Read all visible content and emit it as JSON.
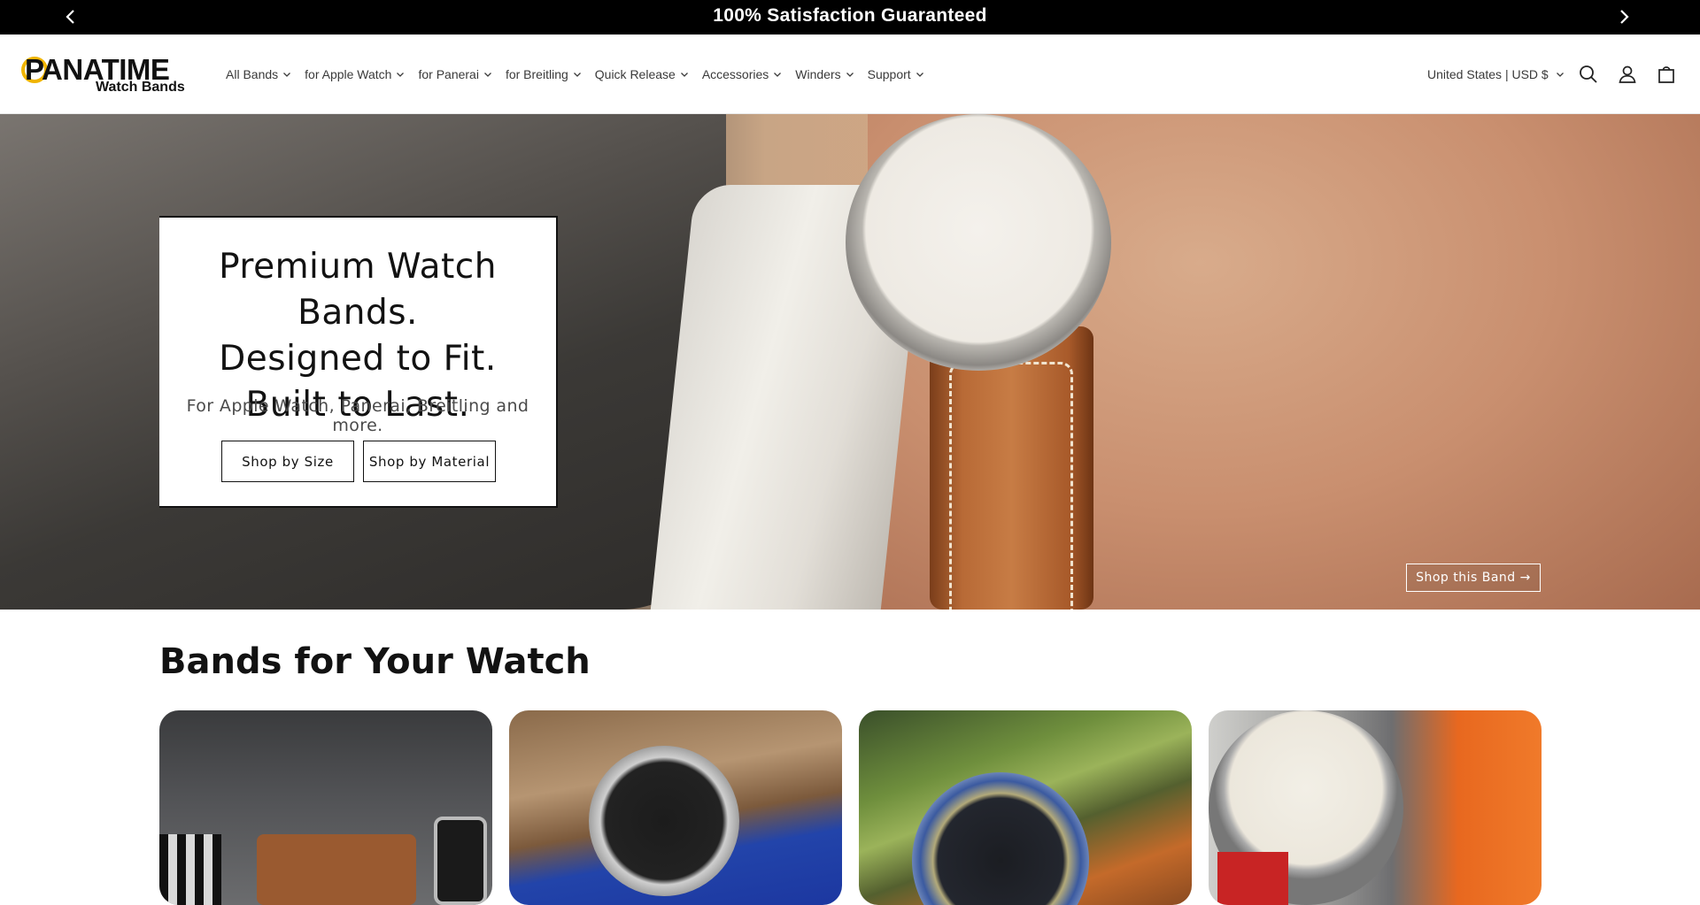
{
  "announcement": {
    "message": "100% Satisfaction Guaranteed",
    "prev_icon": "chevron-left-icon",
    "next_icon": "chevron-right-icon"
  },
  "brand": {
    "logo_word": "PANATIME",
    "logo_sub": "Watch Bands",
    "accent_color": "#f0b400"
  },
  "nav": {
    "items": [
      {
        "label": "All Bands"
      },
      {
        "label": "for Apple Watch"
      },
      {
        "label": "for Panerai"
      },
      {
        "label": "for Breitling"
      },
      {
        "label": "Quick Release"
      },
      {
        "label": "Accessories"
      },
      {
        "label": "Winders"
      },
      {
        "label": "Support"
      }
    ]
  },
  "header": {
    "currency": "United States | USD $",
    "icons": [
      "search-icon",
      "account-icon",
      "cart-icon"
    ]
  },
  "hero": {
    "headline_1": "Premium Watch Bands.",
    "headline_2": "Designed to Fit.",
    "headline_3": "Built to Last.",
    "subtext": "For Apple Watch, Panerai, Breitling and more.",
    "button_size": "Shop by Size",
    "button_material": "Shop by Material",
    "shop_band": "Shop this Band →"
  },
  "section": {
    "title": "Bands for Your Watch",
    "cards": [
      {
        "name": "apple-watch-bands"
      },
      {
        "name": "panerai-bands"
      },
      {
        "name": "breitling-bands"
      },
      {
        "name": "nato-bands"
      }
    ]
  }
}
